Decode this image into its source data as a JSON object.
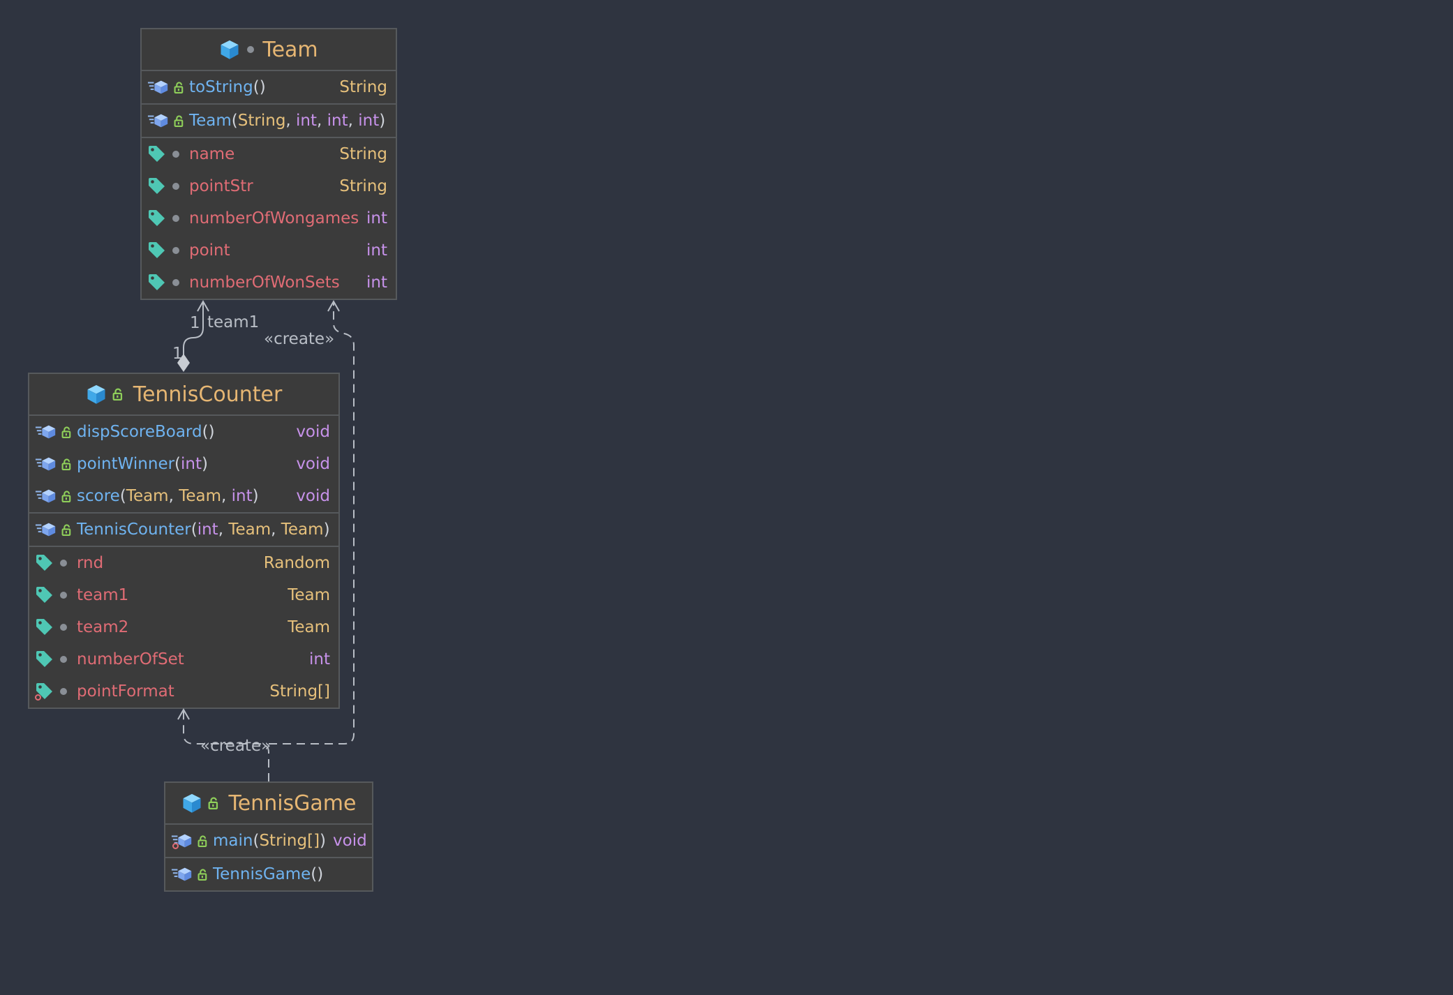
{
  "classes": {
    "team": {
      "name": "Team",
      "methods": [
        {
          "name": "toString",
          "params": "()",
          "type": "String"
        }
      ],
      "constructors": [
        {
          "name": "Team",
          "open": "(",
          "p1": "String",
          "c1": ", ",
          "p2": "int",
          "c2": ", ",
          "p3": "int",
          "c3": ", ",
          "p4": "int",
          "close": ")"
        }
      ],
      "fields": [
        {
          "name": "name",
          "type": "String"
        },
        {
          "name": "pointStr",
          "type": "String"
        },
        {
          "name": "numberOfWongames",
          "type": "int"
        },
        {
          "name": "point",
          "type": "int"
        },
        {
          "name": "numberOfWonSets",
          "type": "int"
        }
      ]
    },
    "tennis_counter": {
      "name": "TennisCounter",
      "methods": [
        {
          "name": "dispScoreBoard",
          "params": "()",
          "type": "void"
        },
        {
          "name": "pointWinner",
          "open": "(",
          "p1": "int",
          "close": ")",
          "type": "void"
        },
        {
          "name": "score",
          "open": "(",
          "p1": "Team",
          "c1": ", ",
          "p2": "Team",
          "c2": ", ",
          "p3": "int",
          "close": ")",
          "type": "void"
        }
      ],
      "constructors": [
        {
          "name": "TennisCounter",
          "open": "(",
          "p1": "int",
          "c1": ", ",
          "p2": "Team",
          "c2": ", ",
          "p3": "Team",
          "close": ")"
        }
      ],
      "fields": [
        {
          "name": "rnd",
          "type": "Random"
        },
        {
          "name": "team1",
          "type": "Team"
        },
        {
          "name": "team2",
          "type": "Team"
        },
        {
          "name": "numberOfSet",
          "type": "int"
        },
        {
          "name": "pointFormat",
          "type": "String[]"
        }
      ]
    },
    "tennis_game": {
      "name": "TennisGame",
      "methods": [
        {
          "name": "main",
          "open": "(",
          "p1": "String[]",
          "close": ")",
          "type": "void"
        }
      ],
      "constructors": [
        {
          "name": "TennisGame",
          "params": "()"
        }
      ]
    }
  },
  "relations": {
    "assoc_role": "team1",
    "assoc_mult_target": "1",
    "assoc_mult_source": "1",
    "create_label_1": "«create»",
    "create_label_2": "«create»"
  },
  "colors": {
    "background": "#2f3440",
    "class_fill": "#3b3b3b",
    "class_border": "#56595c",
    "class_name": "#e6b673",
    "method": "#6fb3f0",
    "field": "#e06c75",
    "keyword_type": "#c792ea",
    "class_type": "#e6c07b",
    "connector": "#b9bec6"
  },
  "icons": [
    "class-icon",
    "package-private-dot-icon",
    "public-lock-icon",
    "method-icon",
    "field-tag-icon",
    "static-marker-icon"
  ]
}
